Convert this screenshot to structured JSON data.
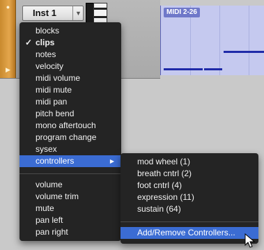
{
  "track": {
    "name": "Inst 1"
  },
  "clip": {
    "title": "MIDI 2-26"
  },
  "view_menu": {
    "items": [
      {
        "label": "blocks",
        "checked": false
      },
      {
        "label": "clips",
        "checked": true
      },
      {
        "label": "notes",
        "checked": false
      },
      {
        "label": "velocity",
        "checked": false
      },
      {
        "label": "midi volume",
        "checked": false
      },
      {
        "label": "midi mute",
        "checked": false
      },
      {
        "label": "midi pan",
        "checked": false
      },
      {
        "label": "pitch bend",
        "checked": false
      },
      {
        "label": "mono aftertouch",
        "checked": false
      },
      {
        "label": "program change",
        "checked": false
      },
      {
        "label": "sysex",
        "checked": false
      },
      {
        "label": "controllers",
        "checked": false,
        "highlighted": true,
        "has_submenu": true
      }
    ],
    "audio_items": [
      {
        "label": "volume"
      },
      {
        "label": "volume trim"
      },
      {
        "label": "mute"
      },
      {
        "label": "pan left"
      },
      {
        "label": "pan right"
      }
    ],
    "check_glyph": "✓"
  },
  "controllers_submenu": {
    "items": [
      {
        "label": "mod wheel (1)"
      },
      {
        "label": "breath cntrl (2)"
      },
      {
        "label": "foot cntrl (4)"
      },
      {
        "label": "expression (11)"
      },
      {
        "label": "sustain (64)"
      }
    ],
    "action": {
      "label": "Add/Remove Controllers...",
      "highlighted": true
    }
  },
  "colors": {
    "menu_bg": "#242424",
    "highlight": "#3b6cd3",
    "clip_bg": "#c5c9ef",
    "note": "#1f2aa8",
    "track_edge": "#e3a64c"
  }
}
